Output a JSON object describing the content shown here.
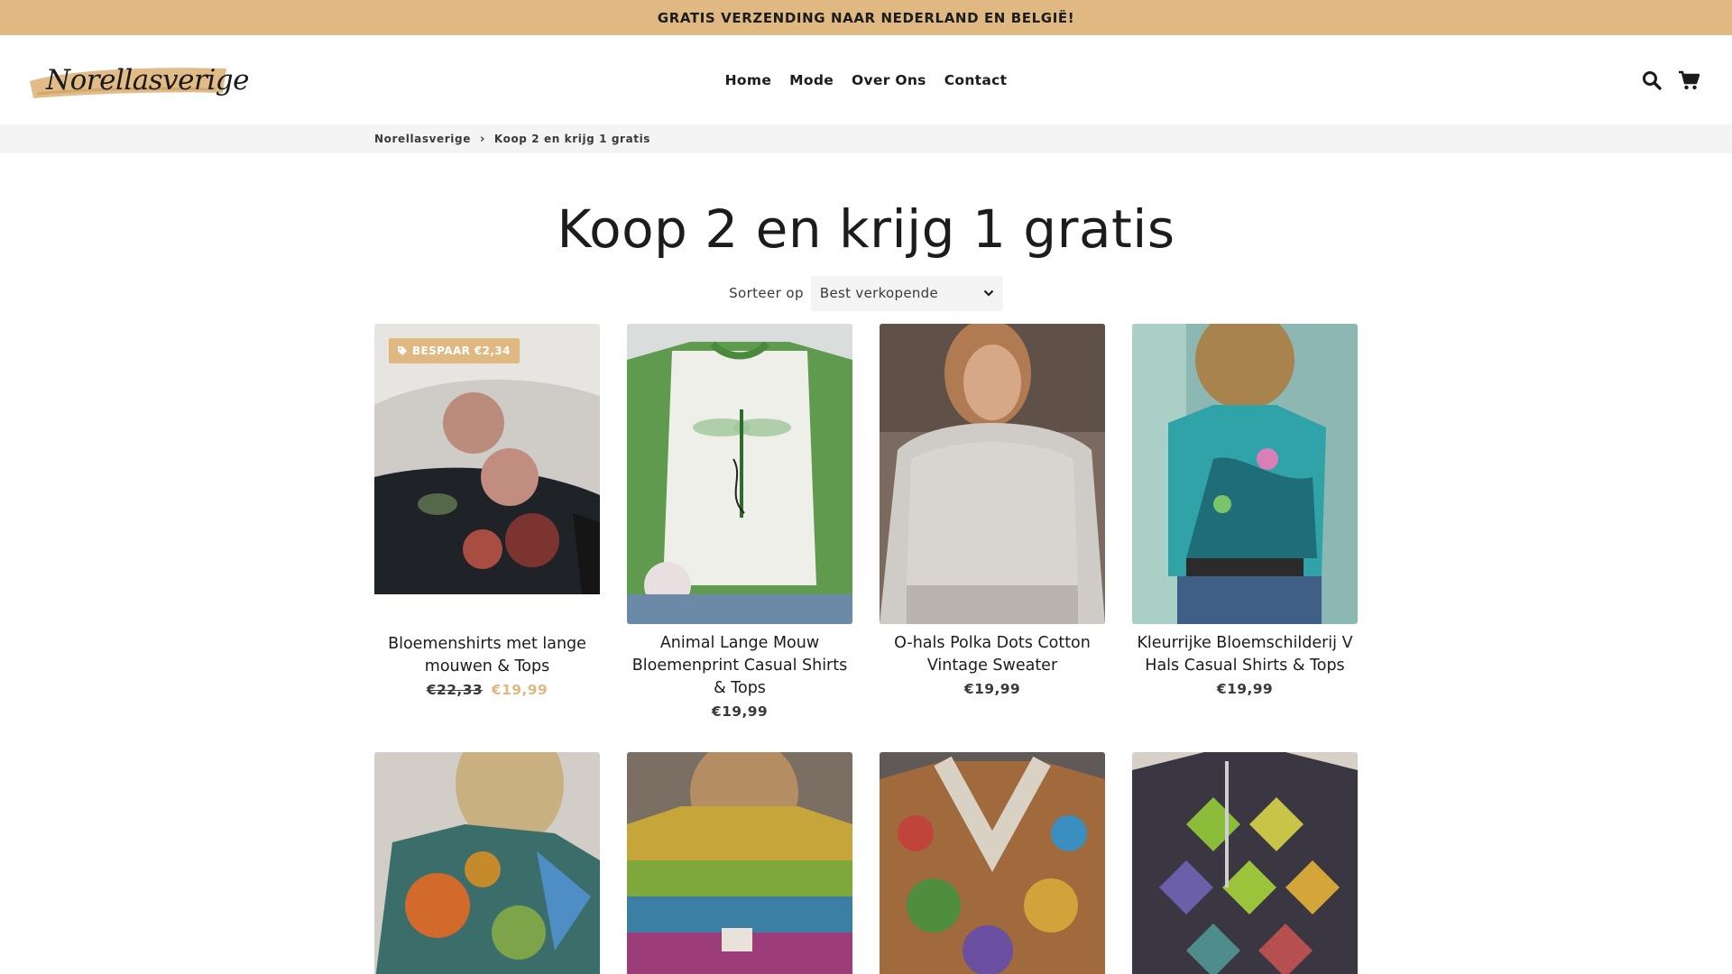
{
  "announcement": {
    "text": "GRATIS VERZENDING NAAR NEDERLAND EN BELGIË!"
  },
  "header": {
    "logo_text": "Norellasverige",
    "nav": [
      "Home",
      "Mode",
      "Over Ons",
      "Contact"
    ],
    "icons": [
      "search-icon",
      "cart-icon"
    ]
  },
  "breadcrumb": {
    "home": "Norellasverige",
    "current": "Koop 2 en krijg 1 gratis"
  },
  "collection": {
    "title": "Koop 2 en krijg 1 gratis",
    "sort_label": "Sorteer op",
    "sort_value": "Best verkopende"
  },
  "products": [
    {
      "name": "Bloemenshirts met lange mouwen & Tops",
      "compare_price": "€22,33",
      "price": "€19,99",
      "badge": "BESPAAR €2,34"
    },
    {
      "name": "Animal Lange Mouw Bloemenprint Casual Shirts & Tops",
      "price": "€19,99"
    },
    {
      "name": "O-hals Polka Dots Cotton Vintage Sweater",
      "price": "€19,99"
    },
    {
      "name": "Kleurrijke Bloemschilderij V Hals Casual Shirts & Tops",
      "price": "€19,99"
    },
    {
      "name": ""
    },
    {
      "name": ""
    },
    {
      "name": ""
    },
    {
      "name": ""
    }
  ],
  "colors": {
    "accent": "#dfb882",
    "text": "#1c1c1c",
    "muted_bg": "#f4f4f4"
  }
}
